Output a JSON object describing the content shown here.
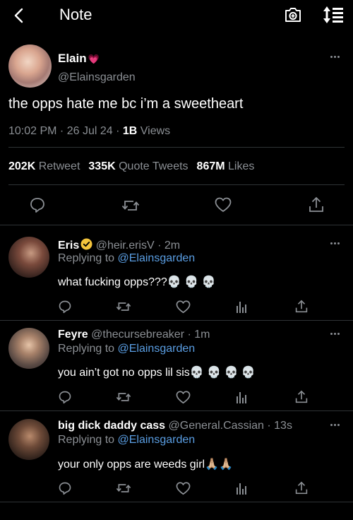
{
  "header": {
    "title": "Note",
    "icons": [
      "back-arrow-icon",
      "camera-add-icon",
      "sort-icon"
    ]
  },
  "tweet": {
    "author_name": "Elain",
    "author_emoji": "💗",
    "handle": "@Elainsgarden",
    "text": "the opps hate me bc i’m a sweetheart",
    "time": "10:02 PM",
    "date": "26 Jul 24",
    "views_count": "1B",
    "views_label": "Views",
    "retweets_count": "202K",
    "retweets_label": "Retweet",
    "quotes_count": "335K",
    "quotes_label": "Quote Tweets",
    "likes_count": "867M",
    "likes_label": "Likes",
    "actions": [
      "reply-icon",
      "retweet-icon",
      "like-icon",
      "share-icon"
    ]
  },
  "replies": [
    {
      "name": "Eris",
      "verified": true,
      "handle": "@heir.erisV",
      "time": "2m",
      "replying_prefix": "Replying to ",
      "replying_to": "@Elainsgarden",
      "text": "what fucking opps???💀 💀 💀"
    },
    {
      "name": "Feyre",
      "verified": false,
      "handle": "@thecursebreaker",
      "time": "1m",
      "replying_prefix": "Replying to ",
      "replying_to": "@Elainsgarden",
      "text": "you ain’t got no opps lil sis💀 💀 💀 💀"
    },
    {
      "name": "big dick daddy cass",
      "verified": false,
      "handle": "@General.Cassian",
      "time": "13s",
      "replying_prefix": "Replying to ",
      "replying_to": "@Elainsgarden",
      "text": "your only opps are weeds girl🙏🏼🙏🏼"
    }
  ],
  "colors": {
    "background": "#000000",
    "text": "#e7e9ea",
    "muted": "#8b8f94",
    "link": "#5a9ee3",
    "divider": "#2f3336",
    "verified": "#f4c43c"
  }
}
